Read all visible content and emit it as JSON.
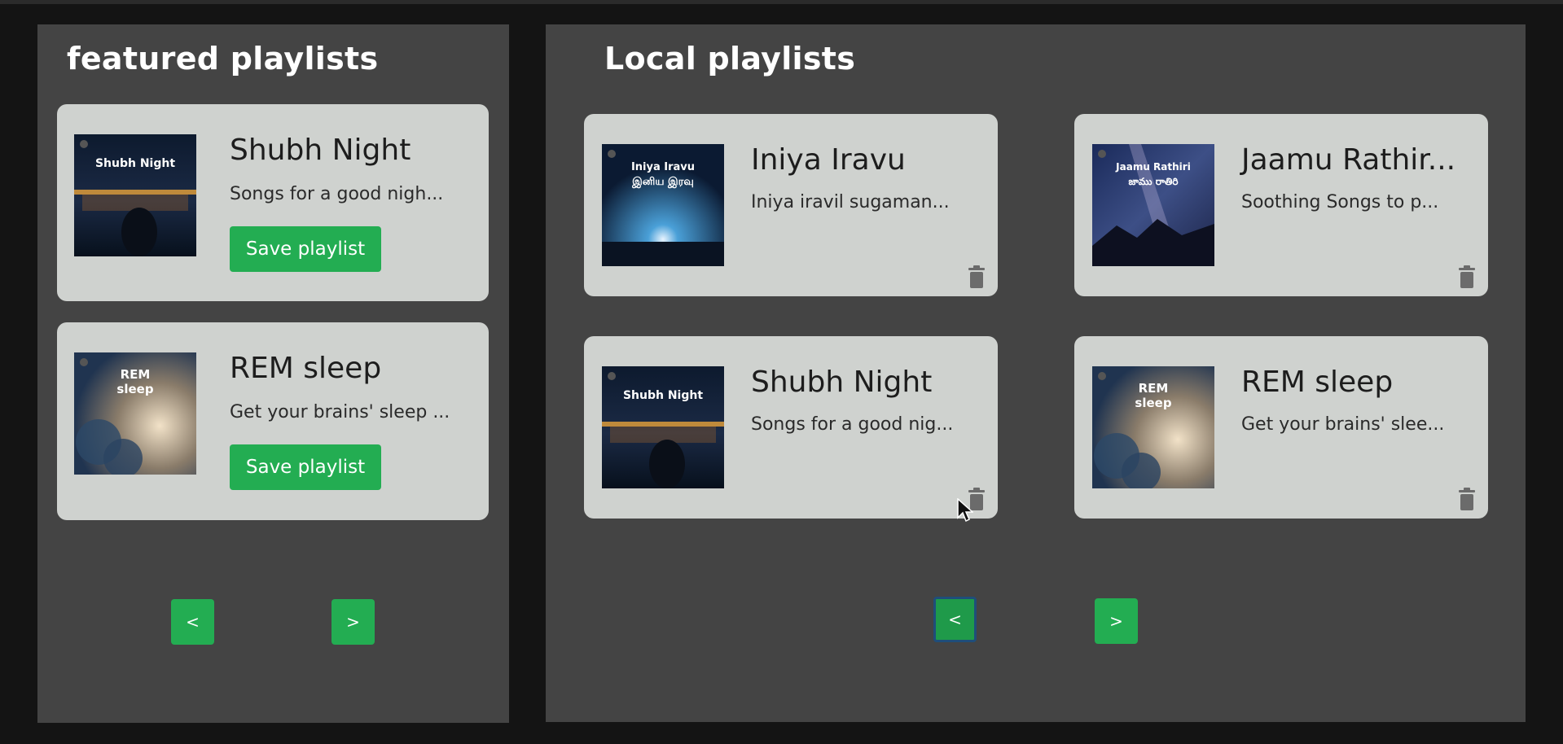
{
  "featured": {
    "title": "featured playlists",
    "playlists": [
      {
        "name": "Shubh Night",
        "description": "Songs for a good nigh...",
        "cover_label": "Shubh Night",
        "save_label": "Save playlist"
      },
      {
        "name": "REM sleep",
        "description": "Get your brains' sleep ...",
        "cover_label_1": "REM",
        "cover_label_2": "sleep",
        "save_label": "Save playlist"
      }
    ],
    "pager": {
      "prev": "<",
      "next": ">"
    }
  },
  "local": {
    "title": "Local playlists",
    "playlists": [
      {
        "name": "Iniya Iravu",
        "description": "Iniya iravil sugaman...",
        "cover_label_1": "Iniya Iravu",
        "cover_label_2": "இனிய இரவு"
      },
      {
        "name": "Jaamu Rathir...",
        "description": "Soothing Songs to p...",
        "cover_label_1": "Jaamu Rathiri",
        "cover_label_2": "జాము రాతిరి"
      },
      {
        "name": "Shubh Night",
        "description": "Songs for a good nig...",
        "cover_label": "Shubh Night"
      },
      {
        "name": "REM sleep",
        "description": "Get your brains' slee...",
        "cover_label_1": "REM",
        "cover_label_2": "sleep"
      }
    ],
    "pager": {
      "prev": "<",
      "next": ">"
    }
  },
  "colors": {
    "background": "#141414",
    "panel": "#444444",
    "card": "#cfd2cf",
    "accent_green": "#23ad52",
    "trash_icon": "#6b6b6b"
  },
  "icons": {
    "delete": "trash-icon",
    "cursor": "mouse-pointer-icon"
  }
}
